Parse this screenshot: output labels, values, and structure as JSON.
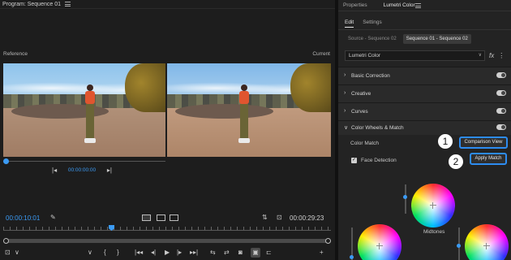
{
  "program": {
    "title": "Program: Sequence 01",
    "reference_label": "Reference",
    "current_label": "Current",
    "reference_timecode": "00:00:00:00",
    "current_timecode": "00:00:10:01",
    "duration_timecode": "00:00:29:23"
  },
  "icons": {
    "step_back": "step-back-icon",
    "step_forward": "step-forward-icon"
  },
  "glyphs": {
    "menu": "≡",
    "step_back": "|◂",
    "step_forward": "▸|",
    "mark_in": "{",
    "mark_out": "}",
    "go_in": "|◂◂",
    "prev_frame": "◂|",
    "play": "▶",
    "next_frame": "|▸",
    "go_out": "▸▸|",
    "insert": "⇆",
    "overwrite": "⇄",
    "camera": "◙",
    "compare": "▣",
    "trim": "⊏",
    "add": "+",
    "settings": "✎",
    "swap": "⇅",
    "fit": "⊡",
    "chevron_down": "∨",
    "chevron_right": "›",
    "check": "✓",
    "kebab": "⋮",
    "fx": "fx"
  },
  "lumetri": {
    "tabs": [
      "Properties",
      "Lumetri Color"
    ],
    "subtabs": [
      "Edit",
      "Settings"
    ],
    "source_seq": "Source - Sequence 02",
    "active_seq": "Sequence 01 - Sequence 02",
    "effect_dropdown": "Lumetri Color",
    "sections": [
      "Basic Correction",
      "Creative",
      "Curves",
      "Color Wheels & Match"
    ],
    "color_match_label": "Color Match",
    "comparison_view_button": "Comparison View",
    "apply_match_button": "Apply Match",
    "face_detection_label": "Face Detection",
    "face_detection_checked": true,
    "midtones_label": "Midtones",
    "badges": [
      "1",
      "2"
    ]
  },
  "colors": {
    "accent": "#2d8cf0",
    "timecode": "#3b9bf5"
  }
}
